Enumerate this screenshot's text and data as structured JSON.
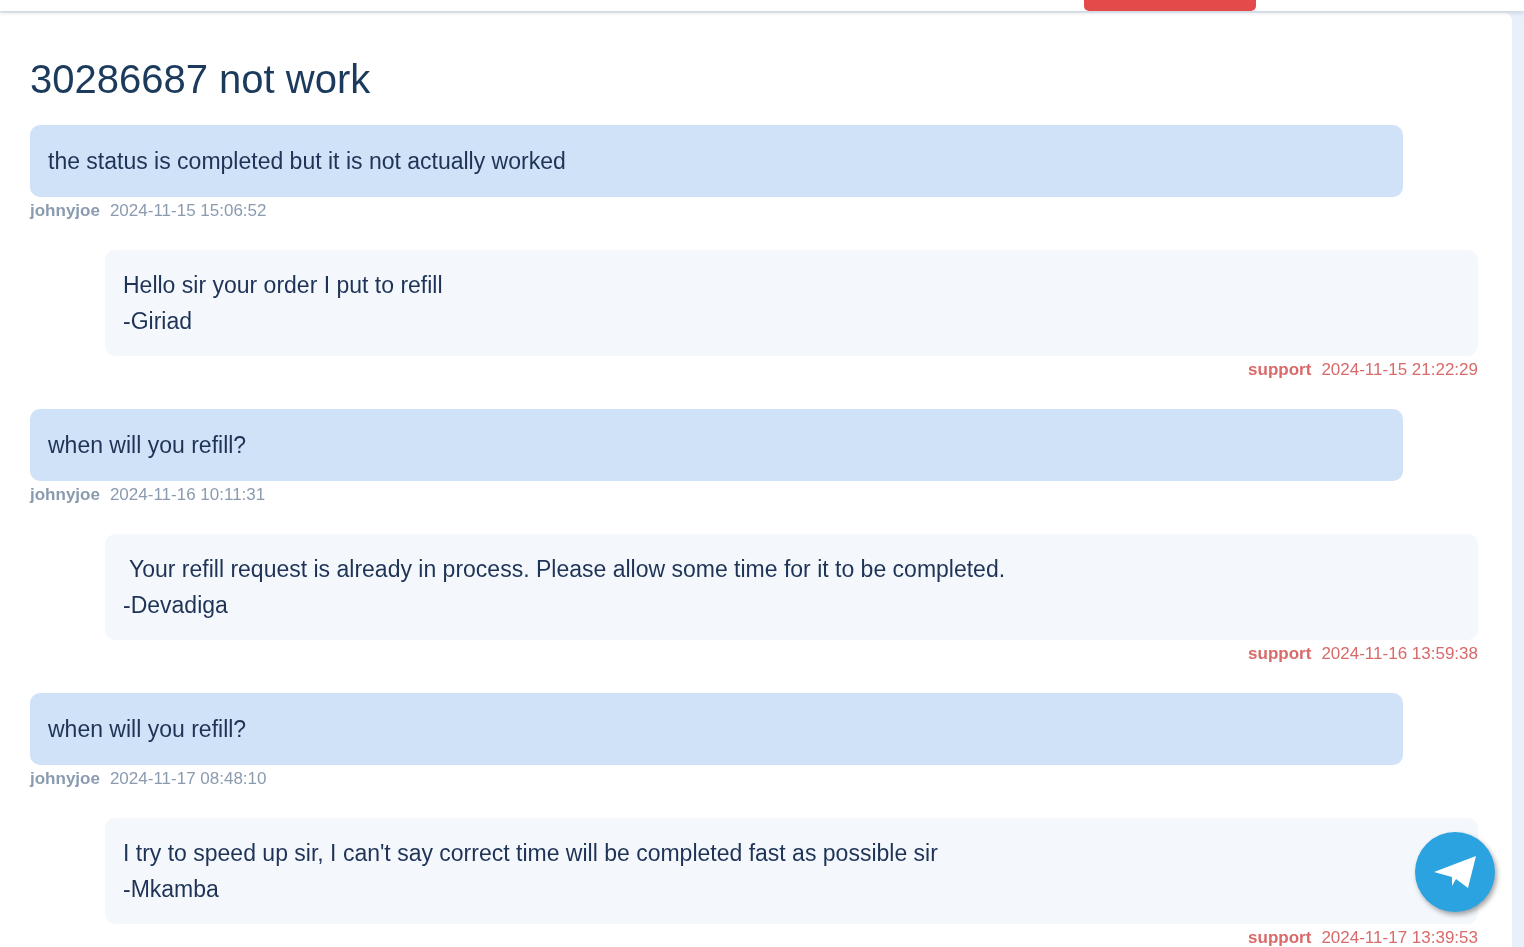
{
  "title": "30286687 not work",
  "messages": [
    {
      "kind": "user",
      "lines": [
        "the status is completed but it is not actually worked"
      ],
      "author": "johnyjoe",
      "time": "2024-11-15 15:06:52"
    },
    {
      "kind": "support",
      "lines": [
        "Hello sir your order I put to refill",
        "-Giriad"
      ],
      "author": "support",
      "time": "2024-11-15 21:22:29"
    },
    {
      "kind": "user",
      "lines": [
        "when will you refill?"
      ],
      "author": "johnyjoe",
      "time": "2024-11-16 10:11:31"
    },
    {
      "kind": "support",
      "lines": [
        " Your refill request is already in process. Please allow some time for it to be completed.",
        "-Devadiga"
      ],
      "author": "support",
      "time": "2024-11-16 13:59:38"
    },
    {
      "kind": "user",
      "lines": [
        "when will you refill?"
      ],
      "author": "johnyjoe",
      "time": "2024-11-17 08:48:10"
    },
    {
      "kind": "support",
      "lines": [
        "I try to speed up sir, I can't say correct time will be completed fast as possible sir",
        "-Mkamba"
      ],
      "author": "support",
      "time": "2024-11-17 13:39:53"
    }
  ]
}
